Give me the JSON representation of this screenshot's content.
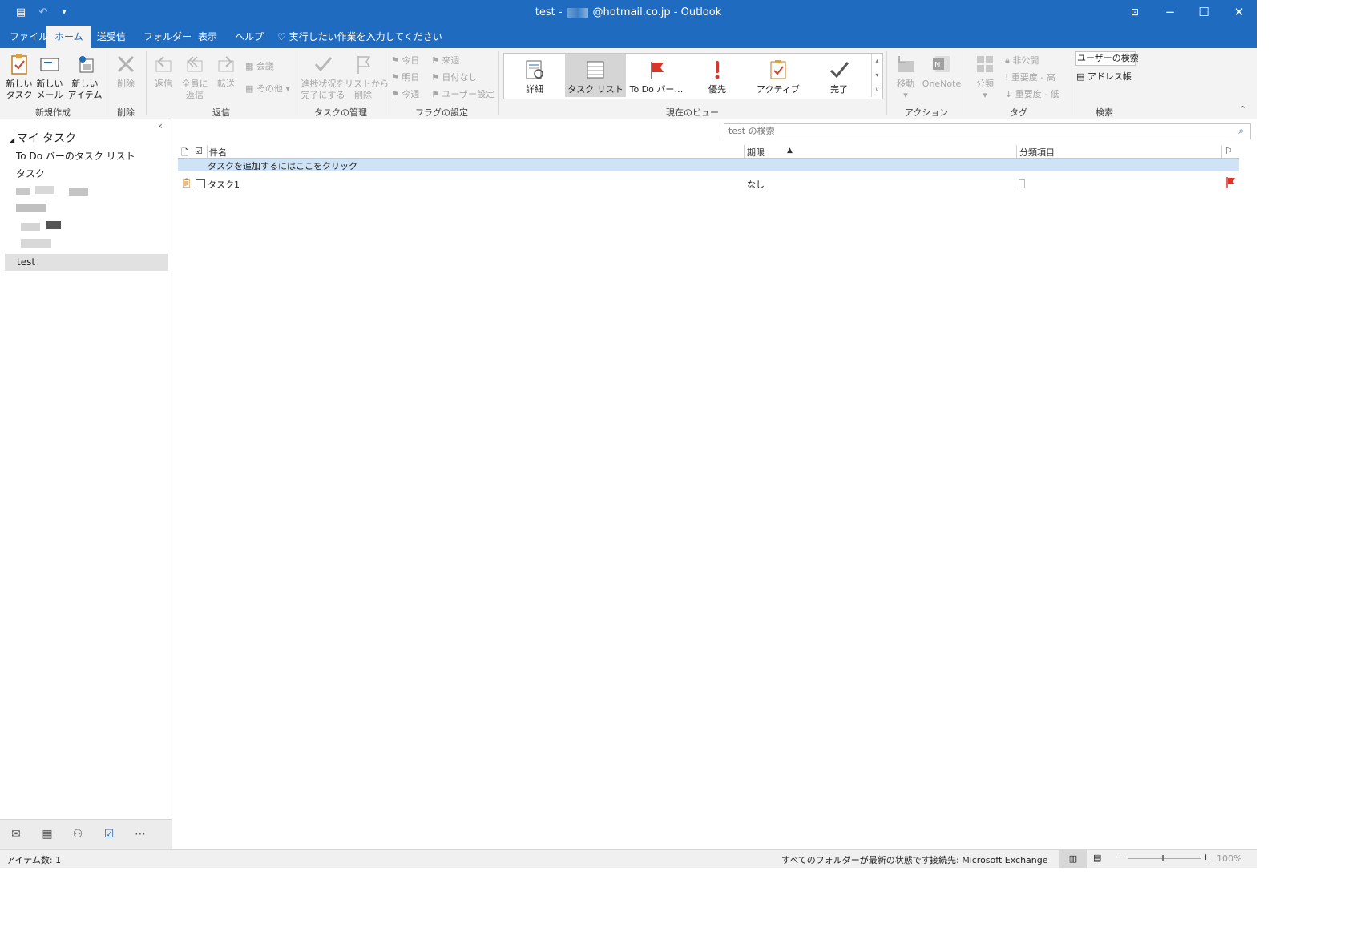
{
  "window": {
    "title_prefix": "test -",
    "title_suffix": "@hotmail.co.jp - Outlook"
  },
  "tabs": [
    "ファイル",
    "ホーム",
    "送受信",
    "フォルダー",
    "表示",
    "ヘルプ"
  ],
  "tell_me": "実行したい作業を入力してください",
  "ribbon": {
    "new_task": "新しい\nタスク",
    "new_mail": "新しい\nメール",
    "new_items": "新しい\nアイテム",
    "group_new": "新規作成",
    "delete": "削除",
    "group_delete": "削除",
    "reply": "返信",
    "reply_all": "全員に\n返信",
    "forward": "転送",
    "meeting": "会議",
    "more": "その他",
    "group_respond": "返信",
    "mark_complete": "進捗状況を\n完了にする",
    "remove_list": "リストから\n削除",
    "group_manage": "タスクの管理",
    "today": "今日",
    "tomorrow": "明日",
    "this_week": "今週",
    "next_week": "来週",
    "no_date": "日付なし",
    "custom": "ユーザー設定",
    "group_flags": "フラグの設定",
    "views": [
      "詳細",
      "タスク リスト",
      "To Do バー…",
      "優先",
      "アクティブ",
      "完了"
    ],
    "group_view": "現在のビュー",
    "move": "移動",
    "onenote": "OneNote",
    "group_actions": "アクション",
    "categorize": "分類",
    "private": "非公開",
    "high": "重要度 - 高",
    "low": "重要度 - 低",
    "group_tags": "タグ",
    "search_people": "ユーザーの検索",
    "address_book": "アドレス帳",
    "group_find": "検索"
  },
  "nav": {
    "header": "マイ タスク",
    "items": [
      "To Do バーのタスク リスト",
      "タスク"
    ],
    "selected": "test"
  },
  "search": {
    "placeholder": "test の検索"
  },
  "columns": {
    "subject": "件名",
    "due": "期限",
    "category": "分類項目"
  },
  "new_task_prompt": "タスクを追加するにはここをクリック",
  "tasks": [
    {
      "subject": "タスク1",
      "due": "なし"
    }
  ],
  "status": {
    "items": "アイテム数: 1",
    "sync": "すべてのフォルダーが最新の状態です。",
    "connection": "接続先: Microsoft Exchange",
    "zoom": "100%"
  },
  "colors": {
    "accent": "#1f6bbf",
    "flag": "#d9362b"
  }
}
